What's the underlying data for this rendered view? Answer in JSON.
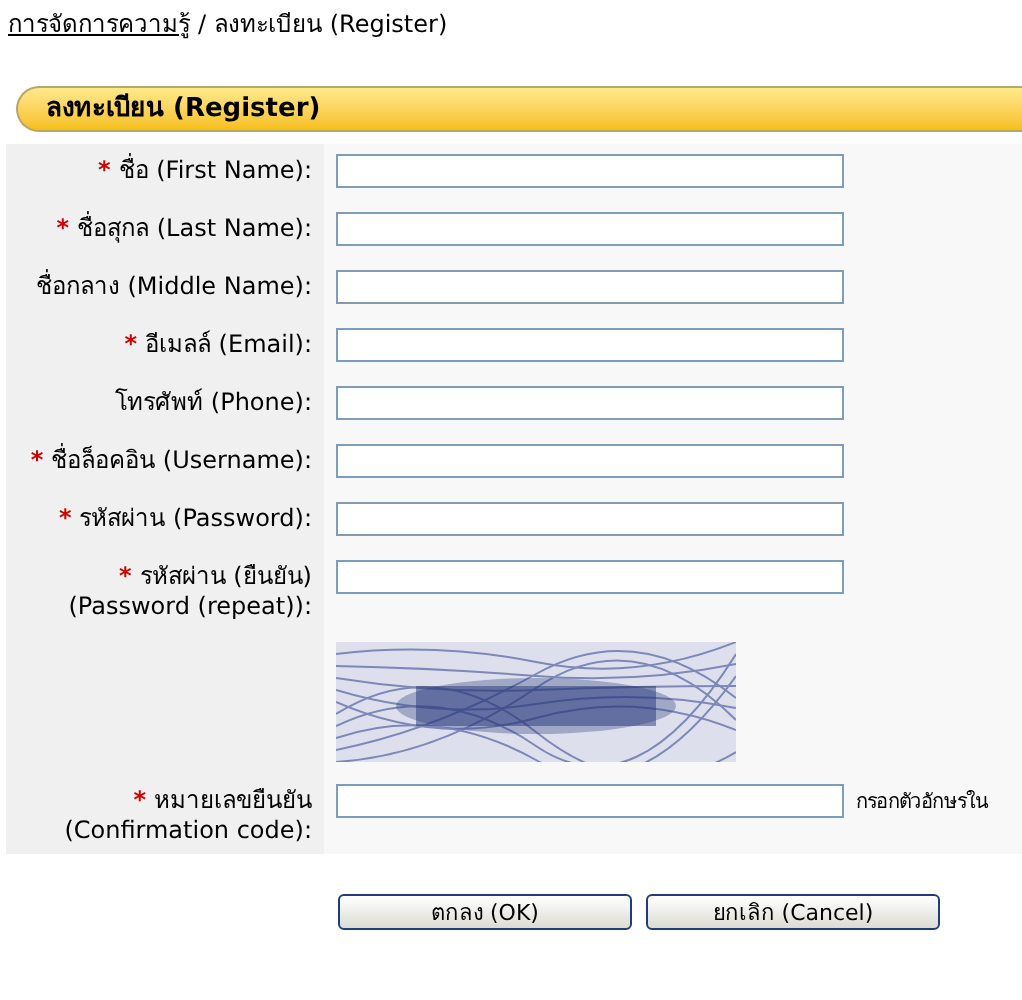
{
  "breadcrumb": {
    "link": "การจัดการความรู้",
    "separator": "/",
    "current": "ลงทะเบียน (Register)"
  },
  "panel": {
    "title": "ลงทะเบียน (Register)"
  },
  "required_mark": "*",
  "rows": [
    {
      "kind": "field",
      "required": true,
      "label": "ชื่อ (First Name):"
    },
    {
      "kind": "field",
      "required": true,
      "label": "ชื่อสุกล (Last Name):"
    },
    {
      "kind": "field",
      "required": false,
      "label": "ชื่อกลาง (Middle Name):"
    },
    {
      "kind": "field",
      "required": true,
      "label": "อีเมลล์ (Email):"
    },
    {
      "kind": "field",
      "required": false,
      "label": "โทรศัพท์ (Phone):"
    },
    {
      "kind": "field",
      "required": true,
      "label": "ชื่อล็อคอิน (Username):"
    },
    {
      "kind": "field",
      "required": true,
      "label": "รหัสผ่าน (Password):"
    },
    {
      "kind": "field",
      "required": true,
      "label": "รหัสผ่าน (ยืนยัน)",
      "label_line_2": "(Password (repeat)):"
    },
    {
      "kind": "captcha"
    },
    {
      "kind": "field",
      "required": true,
      "label": "หมายเลขยืนยัน",
      "label_line_2": "(Confirmation code):",
      "hint": "กรอกตัวอักษรใน"
    }
  ],
  "buttons": [
    "ตกลง (OK)",
    "ยกเลิก (Cancel)"
  ]
}
